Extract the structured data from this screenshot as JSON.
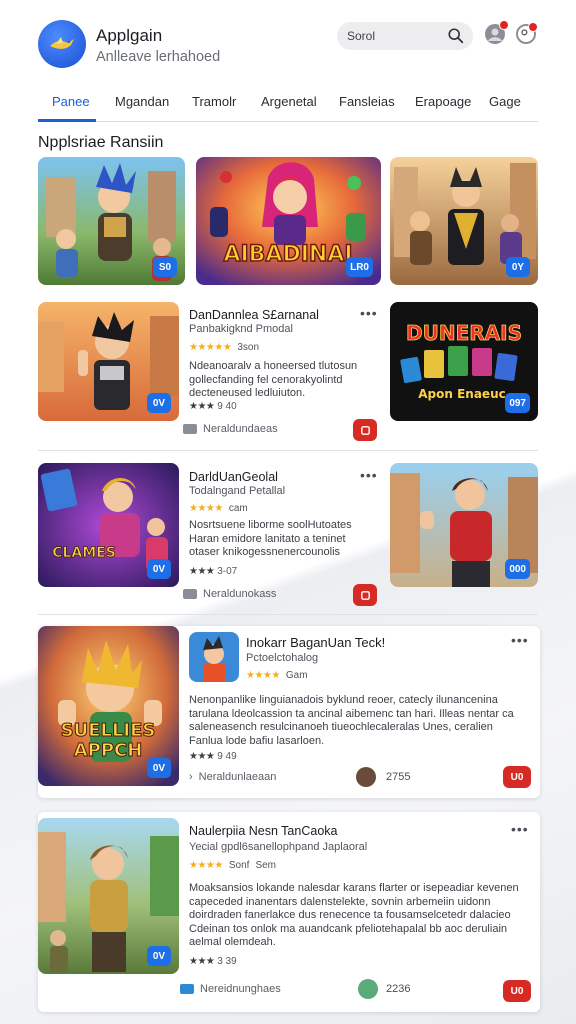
{
  "header": {
    "title": "Applgain",
    "subtitle": "Anlleave lerhahoed",
    "search_placeholder": "Sorol",
    "notif_badge_color": "#e02424"
  },
  "tabs": [
    "Panee",
    "Mgandan",
    "Tramolr",
    "Argenetal",
    "Fansleias",
    "Erapoage",
    "Gage"
  ],
  "section_title": "Npplsriae Ransiin",
  "featured": [
    {
      "tag": "S0"
    },
    {
      "tag": "LR0",
      "art_text": "AIBADINAI"
    },
    {
      "tag": "0Y"
    }
  ],
  "list": [
    {
      "title": "DanDannlea S£arnanal",
      "subtitle": "Panbakigknd Pmodal",
      "stars": "★★★★★",
      "stars_text": "3son",
      "desc": [
        "Ndeanoaralv a honeersed tlutosun",
        "gollecfanding fel cenorakyolintd",
        "decteneused ledluiuton."
      ],
      "meta_stars": "★★★",
      "meta_val": "9 40",
      "tagline": "Neraldundaeas",
      "thumb_tag": "0V",
      "side_tag": "097",
      "side_art_top": "DUNERAIS",
      "side_art_bottom": "Apon Enaeuc"
    },
    {
      "title": "DarldUanGeolal",
      "subtitle": "Todalngand Petallal",
      "stars": "★★★★",
      "stars_text": "cam",
      "desc": [
        "Nosrtsuene liborme soolHutoates",
        "Haran emidore lanitato a teninet",
        "otaser knikogessnenercounolis"
      ],
      "meta_stars": "★★★",
      "meta_val": "3-07",
      "tagline": "Neraldunokass",
      "thumb_tag": "0V",
      "thumb_art": "CLAMES",
      "side_tag": "000"
    }
  ],
  "cards": [
    {
      "title": "Inokarr BaganUan Teck!",
      "subtitle": "Pctoelctohalog",
      "stars": "★★★★",
      "stars_text": "Gam",
      "desc": [
        "Nenonpanlike linguianadois byklund reoer, catecly ilunancenina",
        "tarulana ldeolcassion ta ancinal aibemenc tan hari. Illeas nentar ca",
        "saleneasench resulcinanoeh tiueochlecaleralas Unes, ceralien",
        "Fanlua lode bafiu lasarloen."
      ],
      "meta_stars": "★★★",
      "meta_val": "9 49",
      "tagline": "Neraldunlaeaan",
      "count": "2755",
      "button": "U0",
      "thumb_tag": "0V",
      "thumb_art_1": "SUELLIES",
      "thumb_art_2": "APPCH"
    },
    {
      "title": "Naulerpiia Nesn TanCaoka",
      "subtitle": "Yecial gpdl6sanellophpand Japlaoral",
      "stars": "★★★★",
      "stars_text": "Sonf",
      "stars_text_2": "Sem",
      "desc": [
        "Moaksansios lokande nalesdar karans flarter or isepeadiar kevenen",
        "capeceded inanentars dalenstelekte, sovnin arbemeiin uidonn",
        "doirdraden fanerlakce dus renecence ta fousamselcetedr dalacieo",
        "Cdeinan tos onlok ma auandcank pfeliotehapalal bb aoc deruliain",
        "aelmal olemdeah."
      ],
      "meta_stars": "★★★",
      "meta_val": "3 39",
      "tagline": "Nereidnunghaes",
      "count": "2236",
      "button": "U0",
      "thumb_tag": "0V"
    }
  ],
  "colors": {
    "accent": "#1f5fd6",
    "tag_blue": "#1e6ee8",
    "button_red": "#d62a24",
    "star": "#f2b01e"
  }
}
